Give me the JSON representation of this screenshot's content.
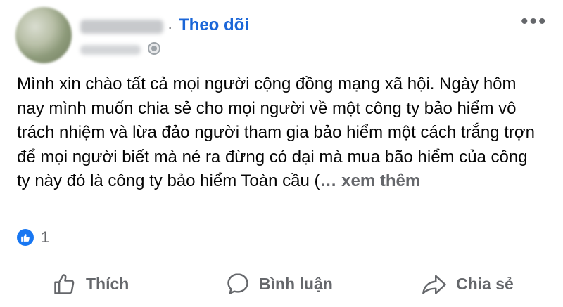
{
  "header": {
    "follow_label": "Theo dõi",
    "separator": "·",
    "more_label": "•••"
  },
  "post": {
    "text": "Mình xin chào tất cả mọi người cộng đồng mạng xã hội. Ngày hôm nay mình muốn chia sẻ cho mọi người về một công ty bảo hiểm vô trách nhiệm và lừa đảo người tham gia bảo hiểm một cách trắng trợn để mọi người biết mà né ra đừng có dại mà mua bão hiểm của công ty này đó là công ty bảo hiểm Toàn cầu (",
    "see_more_label": "… xem thêm"
  },
  "reactions": {
    "count": "1",
    "icon": "thumbs-up-icon",
    "color": "#1877f2"
  },
  "actions": {
    "like_label": "Thích",
    "comment_label": "Bình luận",
    "share_label": "Chia sẻ"
  },
  "colors": {
    "accent": "#1b66d8",
    "muted": "#65676b",
    "text": "#050505"
  }
}
